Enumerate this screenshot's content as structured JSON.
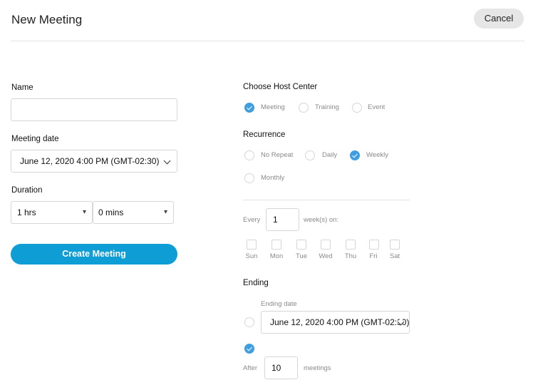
{
  "header": {
    "title": "New Meeting",
    "cancel_label": "Cancel"
  },
  "form": {
    "name_label": "Name",
    "name_value": "",
    "date_label": "Meeting date",
    "date_value": "June 12, 2020 4:00 PM (GMT-02:30)",
    "duration_label": "Duration",
    "hours_value": "1 hrs",
    "mins_value": "0 mins",
    "create_label": "Create Meeting"
  },
  "host_center": {
    "label": "Choose Host Center",
    "options": [
      {
        "label": "Meeting",
        "selected": true
      },
      {
        "label": "Training",
        "selected": false
      },
      {
        "label": "Event",
        "selected": false
      }
    ]
  },
  "recurrence": {
    "label": "Recurrence",
    "options": [
      {
        "label": "No Repeat",
        "selected": false
      },
      {
        "label": "Daily",
        "selected": false
      },
      {
        "label": "Weekly",
        "selected": true
      },
      {
        "label": "Monthly",
        "selected": false
      }
    ],
    "every_label": "Every",
    "every_value": "1",
    "weeks_on_label": "week(s) on:",
    "days": [
      "Sun",
      "Mon",
      "Tue",
      "Wed",
      "Thu",
      "Fri",
      "Sat"
    ]
  },
  "ending": {
    "label": "Ending",
    "ending_date_label": "Ending date",
    "ending_date_value": "June 12, 2020 4:00 PM (GMT-02:30)",
    "after_label": "After",
    "after_value": "10",
    "meetings_label": "meetings",
    "by_date_selected": false,
    "after_selected": true
  }
}
